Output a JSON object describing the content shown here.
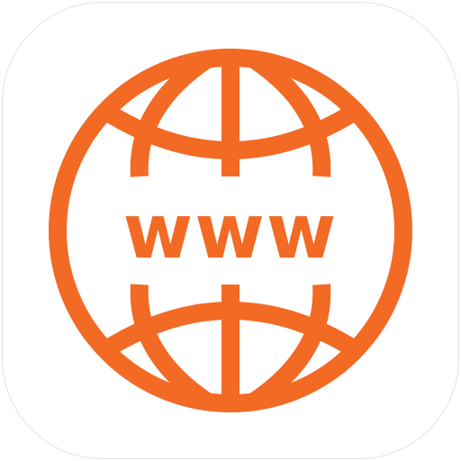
{
  "app_icon": {
    "label": "www",
    "icon": "globe-icon",
    "colors": {
      "accent": "#F26A24",
      "background": "#FFFFFF",
      "border": "#E2E2E2"
    }
  }
}
